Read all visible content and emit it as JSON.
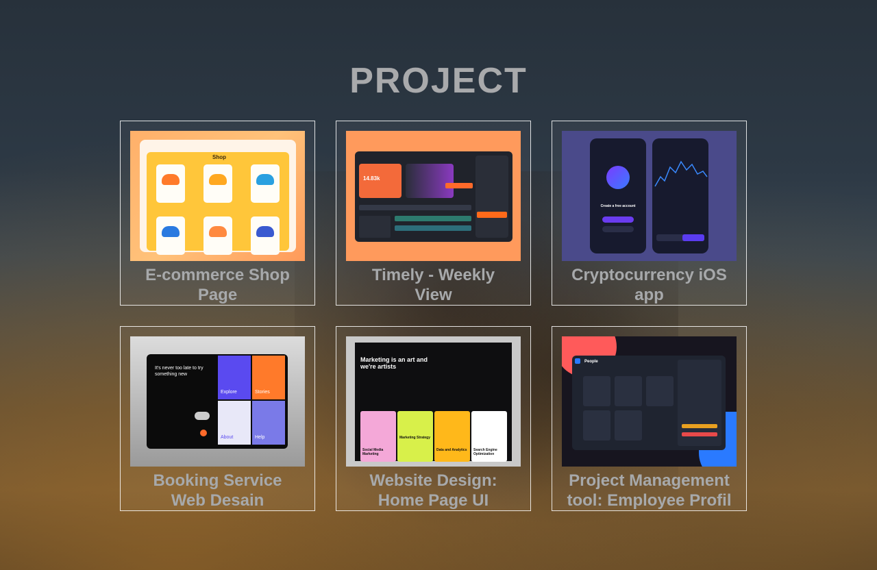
{
  "page": {
    "title": "PROJECT"
  },
  "projects": [
    {
      "title_line1": "E-commerce Shop",
      "title_line2": "Page",
      "thumb_label": "Shop"
    },
    {
      "title_line1": "Timely - Weekly",
      "title_line2": "View",
      "thumb_label": "14.83k"
    },
    {
      "title_line1": "Cryptocurrency iOS",
      "title_line2": "app",
      "thumb_label": "Create a free account"
    },
    {
      "title_line1": "Booking Service",
      "title_line2": "Web Desain",
      "thumb_label": "It's never too late to try something new",
      "tiles": [
        "Explore",
        "Stories",
        "About",
        "Help"
      ]
    },
    {
      "title_line1": "Website Design:",
      "title_line2": "Home Page UI",
      "thumb_label": "Marketing is an art and we're artists",
      "tiles": [
        "Social Media Marketing",
        "Marketing Strategy",
        "Data and Analytics",
        "Search Engine Optimization"
      ]
    },
    {
      "title_line1": "Project Management",
      "title_line2": "tool: Employee Profil",
      "thumb_label": "People"
    }
  ],
  "colors": {
    "title": "#a9aaac",
    "card_border": "#ffffff",
    "card_title": "#a7a9ab"
  }
}
